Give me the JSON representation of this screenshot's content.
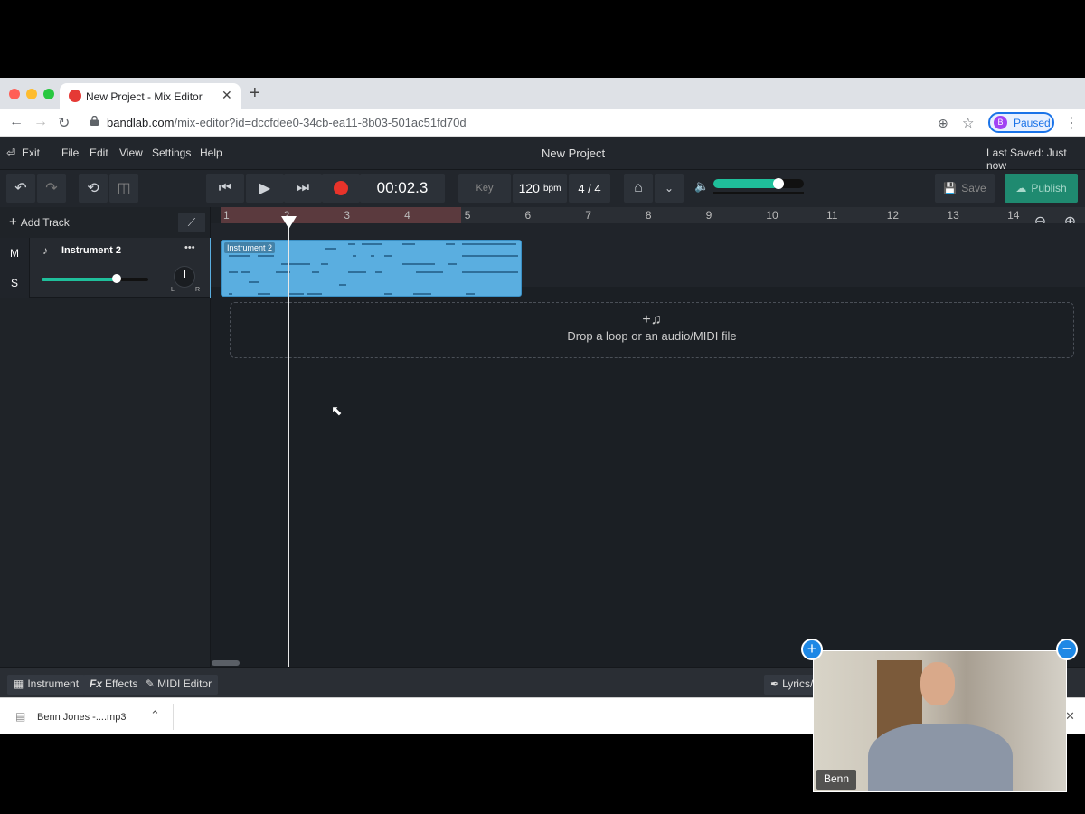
{
  "browser": {
    "tab_title": "New Project - Mix Editor",
    "tab_close": "✕",
    "new_tab": "+",
    "url_host": "bandlab.com",
    "url_path": "/mix-editor?id=dccfdee0-34cb-ea11-8b03-501ac51fd70d",
    "profile_initial": "B",
    "profile_status": "Paused"
  },
  "app": {
    "exit_label": "Exit",
    "menus": [
      "File",
      "Edit",
      "View",
      "Settings",
      "Help"
    ],
    "project_title": "New Project",
    "last_saved": "Last Saved: Just now",
    "time_display": "00:02.3",
    "key_label": "Key",
    "tempo": "120",
    "tempo_unit": "bpm",
    "time_signature": "4 / 4",
    "save_label": "Save",
    "publish_label": "Publish",
    "volume_level": 0.72
  },
  "left_panel": {
    "add_track_label": "Add Track",
    "track": {
      "name": "Instrument 2",
      "mute": "M",
      "solo": "S",
      "more": "•••",
      "pan_left": "L",
      "pan_right": "R",
      "volume_level": 0.7
    }
  },
  "timeline": {
    "bars": [
      "1",
      "2",
      "3",
      "4",
      "5",
      "6",
      "7",
      "8",
      "9",
      "10",
      "11",
      "12",
      "13",
      "14"
    ],
    "clip_label": "Instrument 2",
    "drop_icon": "+♫",
    "drop_text": "Drop a loop or an audio/MIDI file"
  },
  "bottom_tabs": {
    "instrument": "Instrument",
    "effects_prefix": "Fx",
    "effects": "Effects",
    "midi_editor": "MIDI Editor",
    "lyrics": "Lyrics/"
  },
  "downloads": {
    "file_name": "Benn Jones -....mp3",
    "close": "✕"
  },
  "video": {
    "participant": "Benn",
    "add": "+",
    "minimize": "−"
  },
  "colors": {
    "accent_green": "#1fbf9b",
    "clip_blue": "#5aaee0",
    "record_red": "#e8332a",
    "publish_bg": "#1f8a70"
  }
}
